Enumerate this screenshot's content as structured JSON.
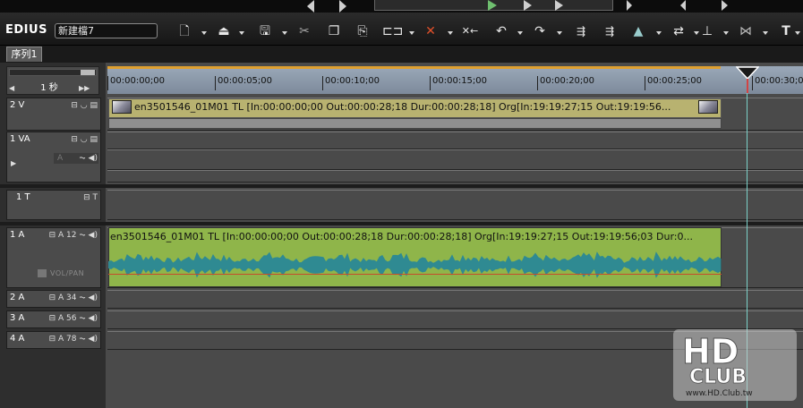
{
  "app": {
    "name": "EDIUS",
    "project_name": "新建檔7"
  },
  "tabs": [
    {
      "label": "序列1"
    }
  ],
  "zoom": {
    "label": "1 秒",
    "left_arrow": "◀",
    "right_arrow": "▶▶"
  },
  "ruler": {
    "timecodes": [
      "00:00:00;00",
      "00:00:05;00",
      "00:00:10;00",
      "00:00:15;00",
      "00:00:20;00",
      "00:00:25;00",
      "00:00:30;00"
    ],
    "playhead": "00:00:29;00"
  },
  "tracks": [
    {
      "name": "2 V",
      "icons": "⊟ ◡ ▤"
    },
    {
      "name": "1 VA",
      "icons": "⊟ ◡ ▤",
      "sub": "A",
      "sub_icons": "⏦ ◀)"
    },
    {
      "name": "1 T",
      "icons": "⊟ T"
    },
    {
      "name": "1 A",
      "icons": "⊟ A 12 ⏦ ◀)",
      "sub_label": "VOL/PAN"
    },
    {
      "name": "2 A",
      "icons": "⊟ A 34 ⏦ ◀)"
    },
    {
      "name": "3 A",
      "icons": "⊟ A 56 ⏦ ◀)"
    },
    {
      "name": "4 A",
      "icons": "⊟ A 78 ⏦ ◀)"
    }
  ],
  "clips": {
    "video_label": "en3501546_01M01  TL [In:00:00:00;00 Out:00:00:28;18 Dur:00:00:28;18]  Org[In:19:19:27;15 Out:19:19:56...",
    "audio_label": "en3501546_01M01  TL [In:00:00:00;00 Out:00:00:28;18 Dur:00:00:28;18]  Org[In:19:19:27;15 Out:19:19:56;03 Dur:0..."
  },
  "watermark": {
    "line1": "HD",
    "line2": "CLUB",
    "url": "www.HD.Club.tw"
  },
  "colors": {
    "video_clip": "#b8b270",
    "audio_clip": "#8fb54a",
    "waveform": "#2f8a92",
    "playhead": "#7ad0c8",
    "ruler_orange": "#e0a030"
  },
  "toolbar_icons": [
    "new-file-icon",
    "open-project-icon",
    "save-icon",
    "cut-icon",
    "copy-icon",
    "paste-icon",
    "replace-icon",
    "delete-icon",
    "ripple-delete-icon",
    "undo-icon",
    "redo-icon",
    "set-in-icon",
    "set-out-icon",
    "add-marker-icon",
    "toggle-sync-icon",
    "mixer-icon",
    "transition-icon",
    "title-icon"
  ]
}
